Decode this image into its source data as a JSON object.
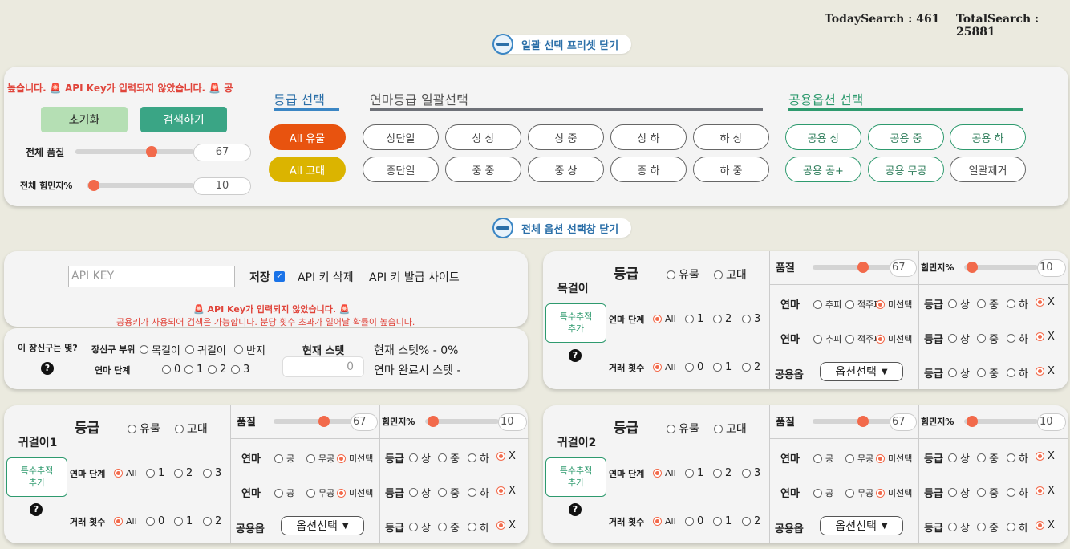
{
  "stats": {
    "today": "TodaySearch : 461",
    "total": "TotalSearch : 25881"
  },
  "preset_toggle": "일괄 선택 프리셋 닫기",
  "option_toggle": "전체 옵션 선택창 닫기",
  "preset": {
    "marquee": "높습니다.      🚨 API Key가 입력되지 않았습니다. 🚨 공",
    "reset": "초기화",
    "search": "검색하기",
    "quality_label": "전체 품질",
    "quality_value": "67",
    "quality_pct": 0.65,
    "stamina_label": "전체 힘민지%",
    "stamina_value": "10",
    "stamina_pct": 0.12,
    "grade_title": "등급 선택",
    "grade_relic": "All 유물",
    "grade_ancient": "All 고대",
    "enlight_title": "연마등급 일괄선택",
    "enlight_row1": [
      "상단일",
      "상 상",
      "상 중",
      "상 하",
      "하 상"
    ],
    "enlight_row2": [
      "중단일",
      "중 중",
      "중 상",
      "중 하",
      "하 중"
    ],
    "common_title": "공용옵션 선택",
    "common_row1": [
      "공용 상",
      "공용 중",
      "공용 하"
    ],
    "common_row2": [
      "공용 공+",
      "공용 무공",
      "일괄제거"
    ]
  },
  "api": {
    "placeholder": "API KEY",
    "save": "저장",
    "delete": "API 키 삭제",
    "issue": "API 키 발급 사이트",
    "warn1": "🚨 API Key가 입력되지 않았습니다. 🚨",
    "warn2": "공용키가 사용되어 검색은 가능합니다. 분당 횟수 초과가 일어날 확률이 높습니다."
  },
  "accessory": {
    "question": "이 장신구는 몇?",
    "help": "?",
    "part_label": "장신구 부위",
    "parts": [
      "목걸이",
      "귀걸이",
      "반지"
    ],
    "level_label": "연마 단계",
    "levels": [
      "0",
      "1",
      "2",
      "3"
    ],
    "stat_label": "현재 스텟",
    "stat_value": "0",
    "stat_pct": "현재 스텟% - 0%",
    "stat_done": "연마 완료시 스텟 -"
  },
  "common": {
    "grade": "등급",
    "relic": "유물",
    "ancient": "고대",
    "quality": "품질",
    "quality_value": "67",
    "quality_pct": 0.72,
    "stamina": "힘민지%",
    "stamina_value": "10",
    "stamina_pct": 0.12,
    "special": "특수추적 추가",
    "help": "?",
    "level_label": "연마 단계",
    "levels": [
      "All",
      "1",
      "2",
      "3"
    ],
    "trade_label": "거래 횟수",
    "trades": [
      "All",
      "0",
      "1",
      "2"
    ],
    "enlight": "연마",
    "common_opt": "공용옵",
    "select": "옵션선택",
    "grade2": "등급",
    "grades": [
      "상",
      "중",
      "하",
      "X"
    ],
    "undecided": "미선택"
  },
  "panels": [
    {
      "name": "목걸이",
      "opts": [
        "추피",
        "적주피"
      ]
    },
    {
      "name": "귀걸이1",
      "opts": [
        "공",
        "무공"
      ]
    },
    {
      "name": "귀걸이2",
      "opts": [
        "공",
        "무공"
      ]
    }
  ]
}
